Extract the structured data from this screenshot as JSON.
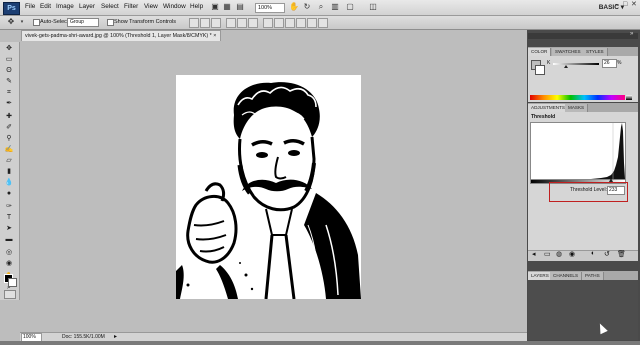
{
  "menubar": {
    "logo": "Ps",
    "items": [
      "File",
      "Edit",
      "Image",
      "Layer",
      "Select",
      "Filter",
      "View",
      "Window",
      "Help"
    ],
    "zoom": "100%",
    "workspace": "BASIC",
    "workspace_arrow": "▾",
    "window_controls": [
      "–",
      "□",
      "✕"
    ]
  },
  "options": {
    "auto_select_label": "Auto-Select:",
    "auto_select_value": "Group",
    "transform_label": "Show Transform Controls"
  },
  "document": {
    "tab_title": "vivek-gets-padma-shri-award.jpg @ 100% (Threshold 1, Layer Mask/8/CMYK) *",
    "tab_close": "×",
    "zoom": "100%",
    "doc_info": "Doc: 155.5K/1.00M"
  },
  "panels": {
    "color_tabs": [
      "COLOR",
      "SWATCHES",
      "STYLES"
    ],
    "color_value": "26",
    "color_unit": "%",
    "channel_label": "K",
    "adjust_tabs": [
      "ADJUSTMENTS",
      "MASKS"
    ],
    "threshold_title": "Threshold",
    "threshold_label": "Threshold Level:",
    "threshold_value": "233",
    "layers_tabs": [
      "LAYERS",
      "CHANNELS",
      "PATHS"
    ]
  },
  "colors": {
    "accent_red": "#c02020"
  }
}
